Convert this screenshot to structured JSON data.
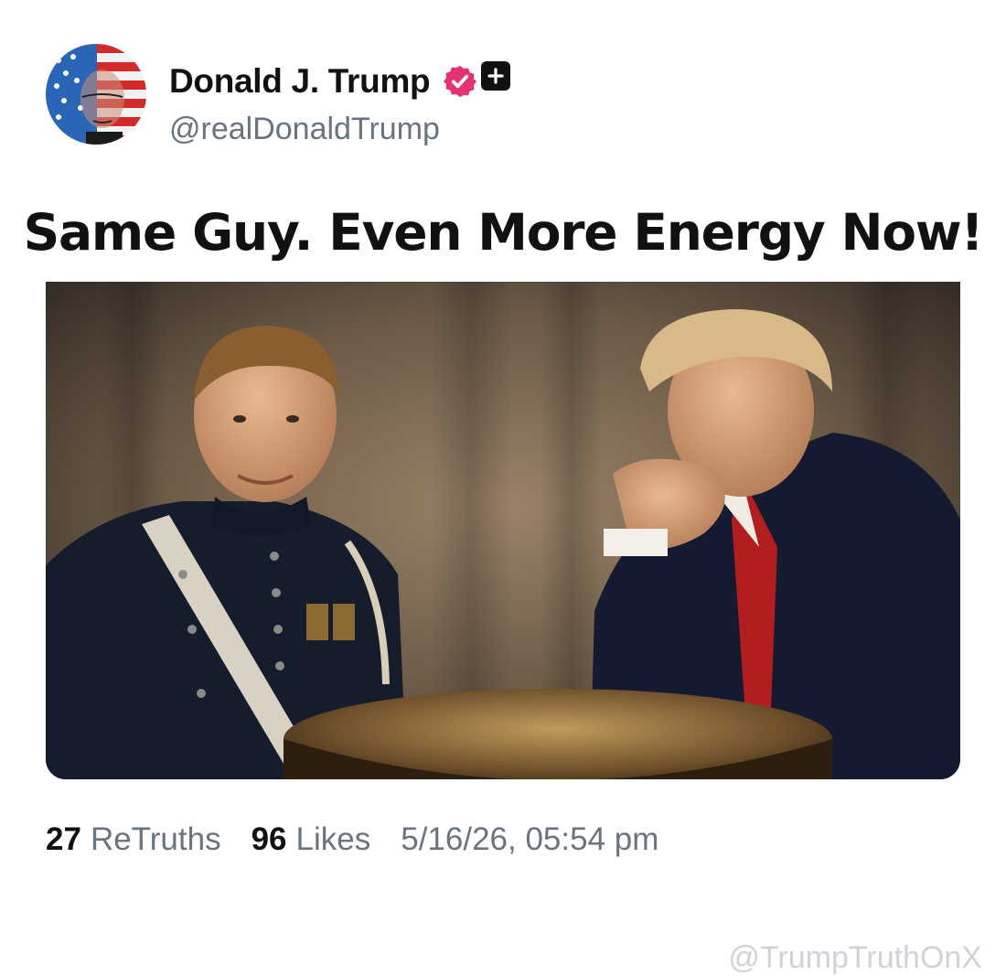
{
  "post": {
    "author": {
      "display_name": "Donald J. Trump",
      "handle": "@realDonaldTrump",
      "avatar": "avatar-flag-portrait",
      "verified_icon": "verified-badge-icon",
      "verified_color": "#e5336f",
      "extra_icon": "plus-square-icon"
    },
    "title": "Same Guy. Even More Energy Now!",
    "image": {
      "description_icon": "photo-image"
    },
    "stats": {
      "retruths_count": "27",
      "retruths_label": "ReTruths",
      "likes_count": "96",
      "likes_label": "Likes",
      "timestamp": "5/16/26, 05:54 pm"
    }
  },
  "watermark": "@TrumpTruthOnX",
  "colors": {
    "text_primary": "#111111",
    "text_secondary": "#687482",
    "watermark": "#cfd3d8",
    "verified_badge": "#e5336f"
  }
}
